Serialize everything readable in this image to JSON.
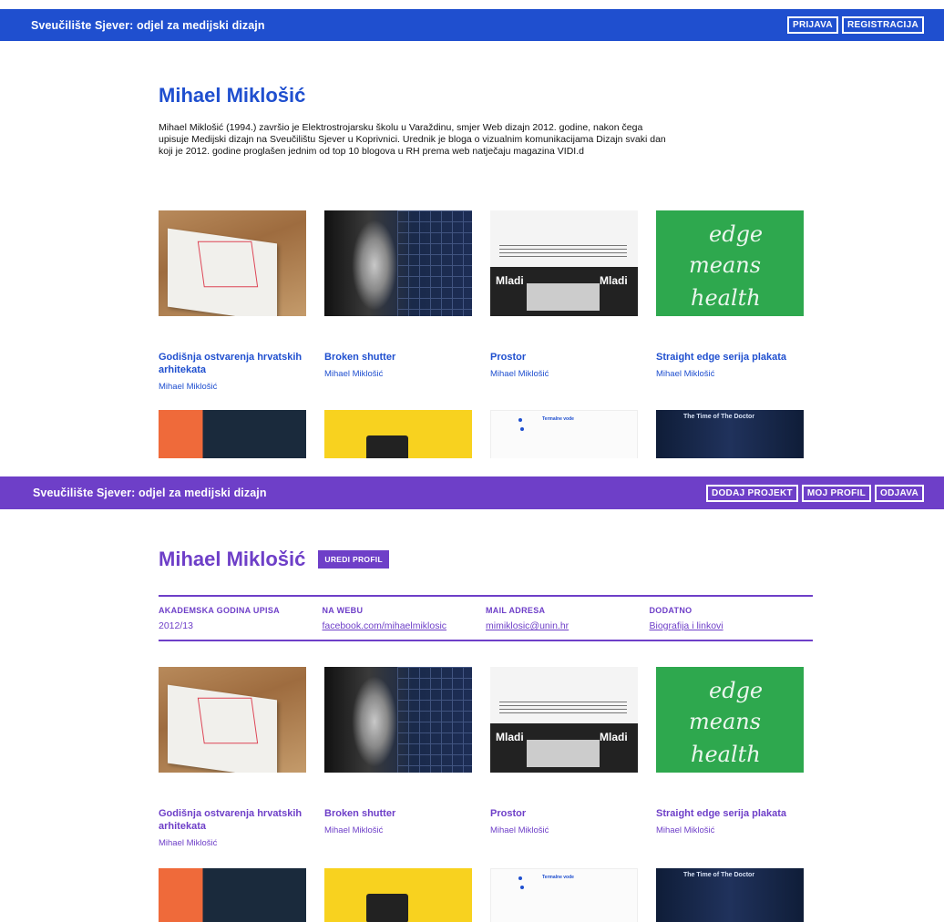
{
  "top": {
    "brand": "Sveučilište Sjever: odjel za medijski dizajn",
    "nav": [
      "PRIJAVA",
      "REGISTRACIJA"
    ],
    "name": "Mihael Miklošić",
    "bio": "Mihael Miklošić (1994.) završio je Elektrostrojarsku školu u Varaždinu, smjer Web dizajn 2012. godine, nakon čega upisuje Medijski dizajn na Sveučilištu Sjever u Koprivnici. Urednik je bloga o vizualnim komunikacijama Dizajn svaki dan koji je 2012. godine proglašen jednim od top 10 blogova u RH prema web natječaju magazina VIDI.d"
  },
  "bottom": {
    "brand": "Sveučilište Sjever: odjel za medijski dizajn",
    "nav": [
      "DODAJ PROJEKT",
      "MOJ PROFIL",
      "ODJAVA"
    ],
    "name": "Mihael Miklošić",
    "edit_label": "UREDI PROFIL",
    "info": [
      {
        "label": "AKADEMSKA GODINA UPISA",
        "value": "2012/13"
      },
      {
        "label": "NA WEBU",
        "value": "facebook.com/mihaelmiklosic"
      },
      {
        "label": "MAIL ADRESA",
        "value": "mimiklosic@unin.hr"
      },
      {
        "label": "DODATNO",
        "value": "Biografija i linkovi"
      }
    ]
  },
  "projects": [
    {
      "title": "Godišnja ostvarenja hrvatskih arhitekata",
      "author": "Mihael Miklošić",
      "thumb": "book-icon"
    },
    {
      "title": "Broken shutter",
      "author": "Mihael Miklošić",
      "thumb": "photo-icon"
    },
    {
      "title": "Prostor",
      "author": "Mihael Miklošić",
      "thumb": "poster-icon"
    },
    {
      "title": "Straight edge serija plakata",
      "author": "Mihael Miklošić",
      "thumb": "poster-icon"
    }
  ],
  "thumb_text": {
    "poster_left": "Mladi",
    "poster_right": "Mladi",
    "green_1": "edge",
    "green_2": "means",
    "green_3": "health",
    "white_label": "Termalne vode",
    "navy_label": "The Time of The Doctor"
  },
  "colors": {
    "top_bar": "#1f4fcf",
    "bottom_bar": "#6e3fc8"
  }
}
